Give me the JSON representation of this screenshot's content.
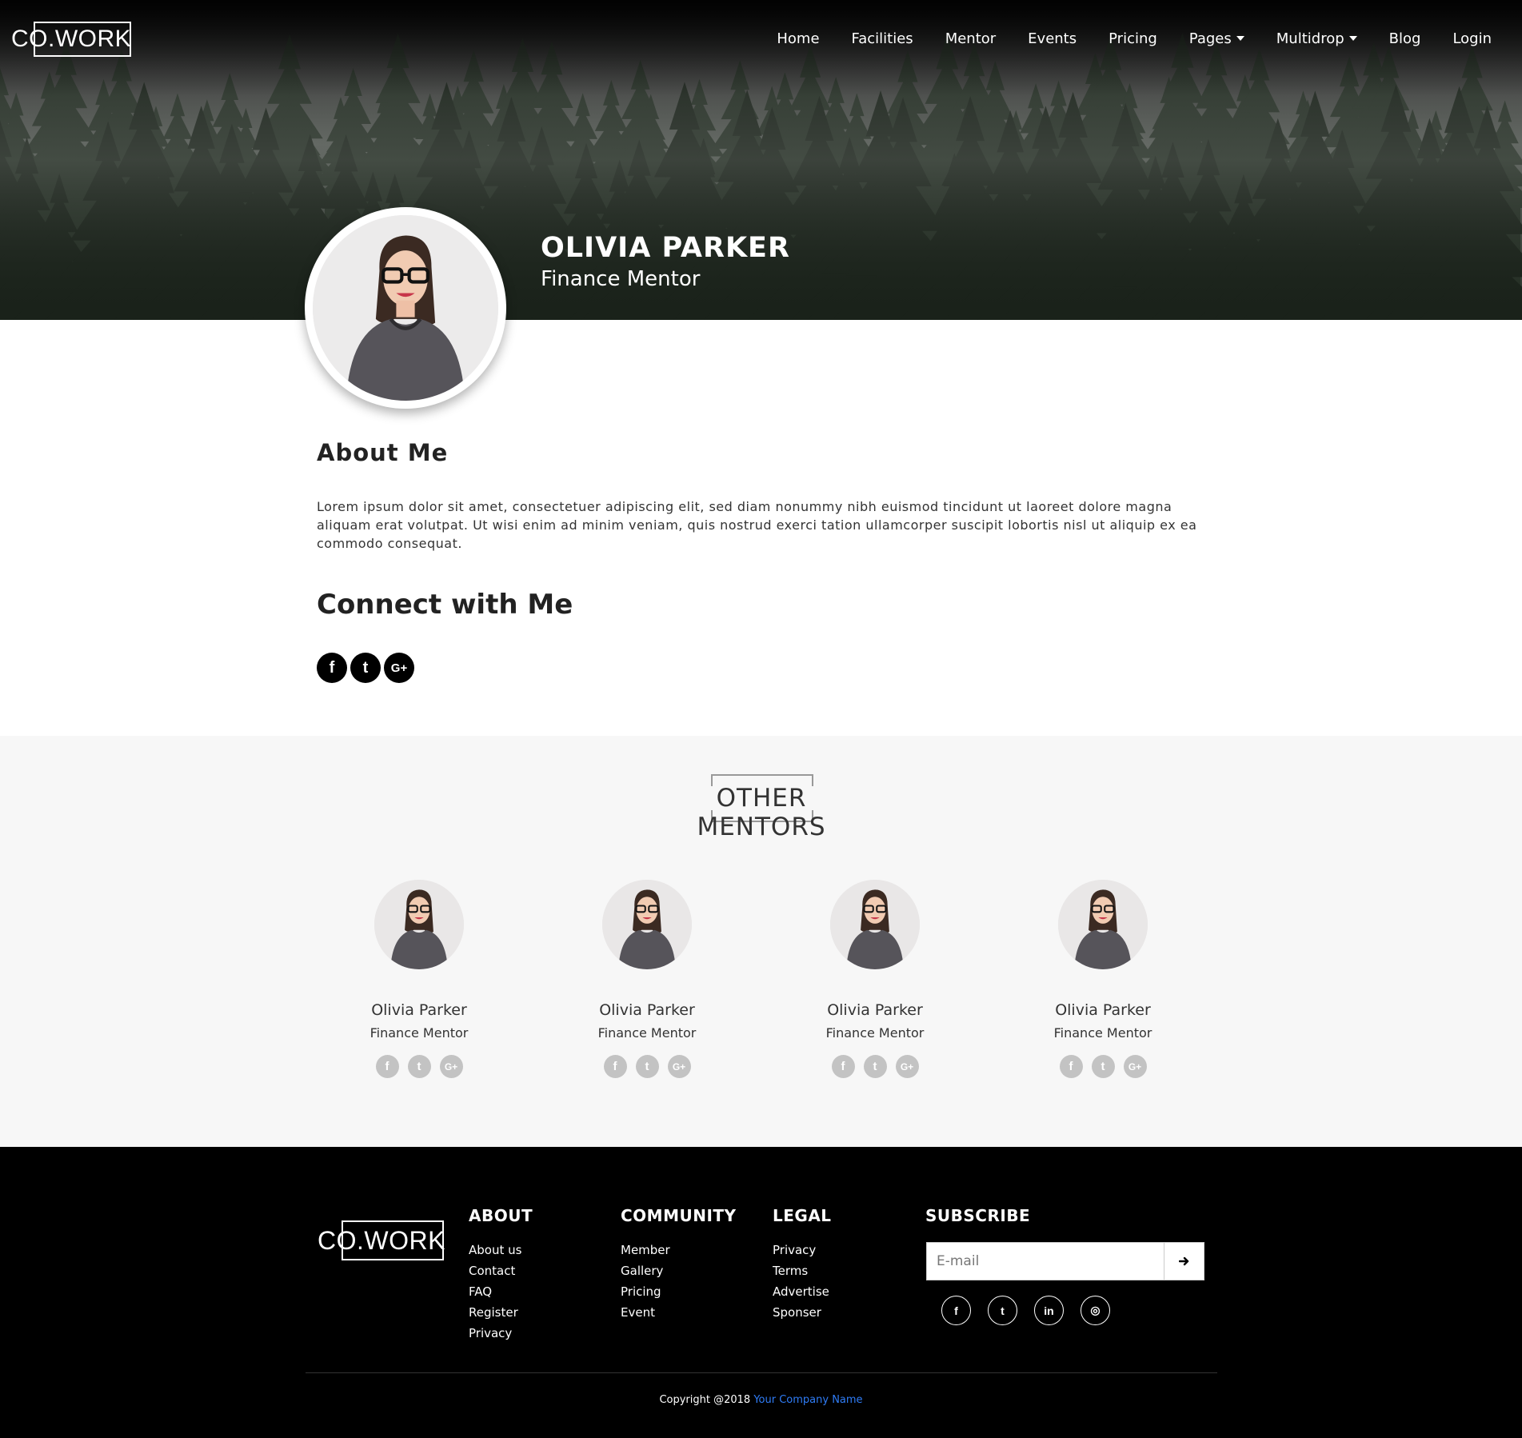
{
  "brand": {
    "logo_text": "CO.WORK"
  },
  "nav": {
    "items": [
      {
        "label": "Home",
        "dropdown": false
      },
      {
        "label": "Facilities",
        "dropdown": false
      },
      {
        "label": "Mentor",
        "dropdown": false
      },
      {
        "label": "Events",
        "dropdown": false
      },
      {
        "label": "Pricing",
        "dropdown": false
      },
      {
        "label": "Pages",
        "dropdown": true
      },
      {
        "label": "Multidrop",
        "dropdown": true
      },
      {
        "label": "Blog",
        "dropdown": false
      },
      {
        "label": "Login",
        "dropdown": false
      }
    ]
  },
  "profile": {
    "name": "OLIVIA PARKER",
    "role": "Finance Mentor"
  },
  "about": {
    "title": "About Me",
    "text": "Lorem ipsum dolor sit amet, consectetuer adipiscing elit, sed diam nonummy nibh euismod tincidunt ut laoreet dolore magna aliquam erat volutpat. Ut wisi enim ad minim veniam, quis nostrud exerci tation ullamcorper suscipit lobortis nisl ut aliquip ex ea commodo consequat."
  },
  "connect": {
    "title": "Connect with Me",
    "icons": [
      {
        "name": "facebook",
        "glyph": "f"
      },
      {
        "name": "twitter",
        "glyph": "t"
      },
      {
        "name": "google-plus",
        "glyph": "G+"
      }
    ]
  },
  "other_mentors": {
    "title": "OTHER MENTORS",
    "mentors": [
      {
        "name": "Olivia Parker",
        "role": "Finance Mentor"
      },
      {
        "name": "Olivia Parker",
        "role": "Finance Mentor"
      },
      {
        "name": "Olivia Parker",
        "role": "Finance Mentor"
      },
      {
        "name": "Olivia Parker",
        "role": "Finance Mentor"
      }
    ],
    "icon_glyphs": [
      "f",
      "t",
      "G+"
    ]
  },
  "footer": {
    "about": {
      "title": "ABOUT",
      "links": [
        "About us",
        "Contact",
        "FAQ",
        "Register",
        "Privacy"
      ]
    },
    "community": {
      "title": "COMMUNITY",
      "links": [
        "Member",
        "Gallery",
        "Pricing",
        "Event"
      ]
    },
    "legal": {
      "title": "LEGAL",
      "links": [
        "Privacy",
        "Terms",
        "Advertise",
        "Sponser"
      ]
    },
    "subscribe": {
      "title": "SUBSCRIBE",
      "placeholder": "E-mail",
      "social": [
        {
          "name": "facebook",
          "glyph": "f"
        },
        {
          "name": "twitter",
          "glyph": "t"
        },
        {
          "name": "linkedin",
          "glyph": "in"
        },
        {
          "name": "instagram",
          "glyph": "◎"
        }
      ]
    },
    "copyright_prefix": "Copyright @2018",
    "company_link": "Your Company Name"
  },
  "colors": {
    "footer_bg": "#000000",
    "link_blue": "#2f7cf6",
    "section_bg": "#f7f7f7"
  }
}
